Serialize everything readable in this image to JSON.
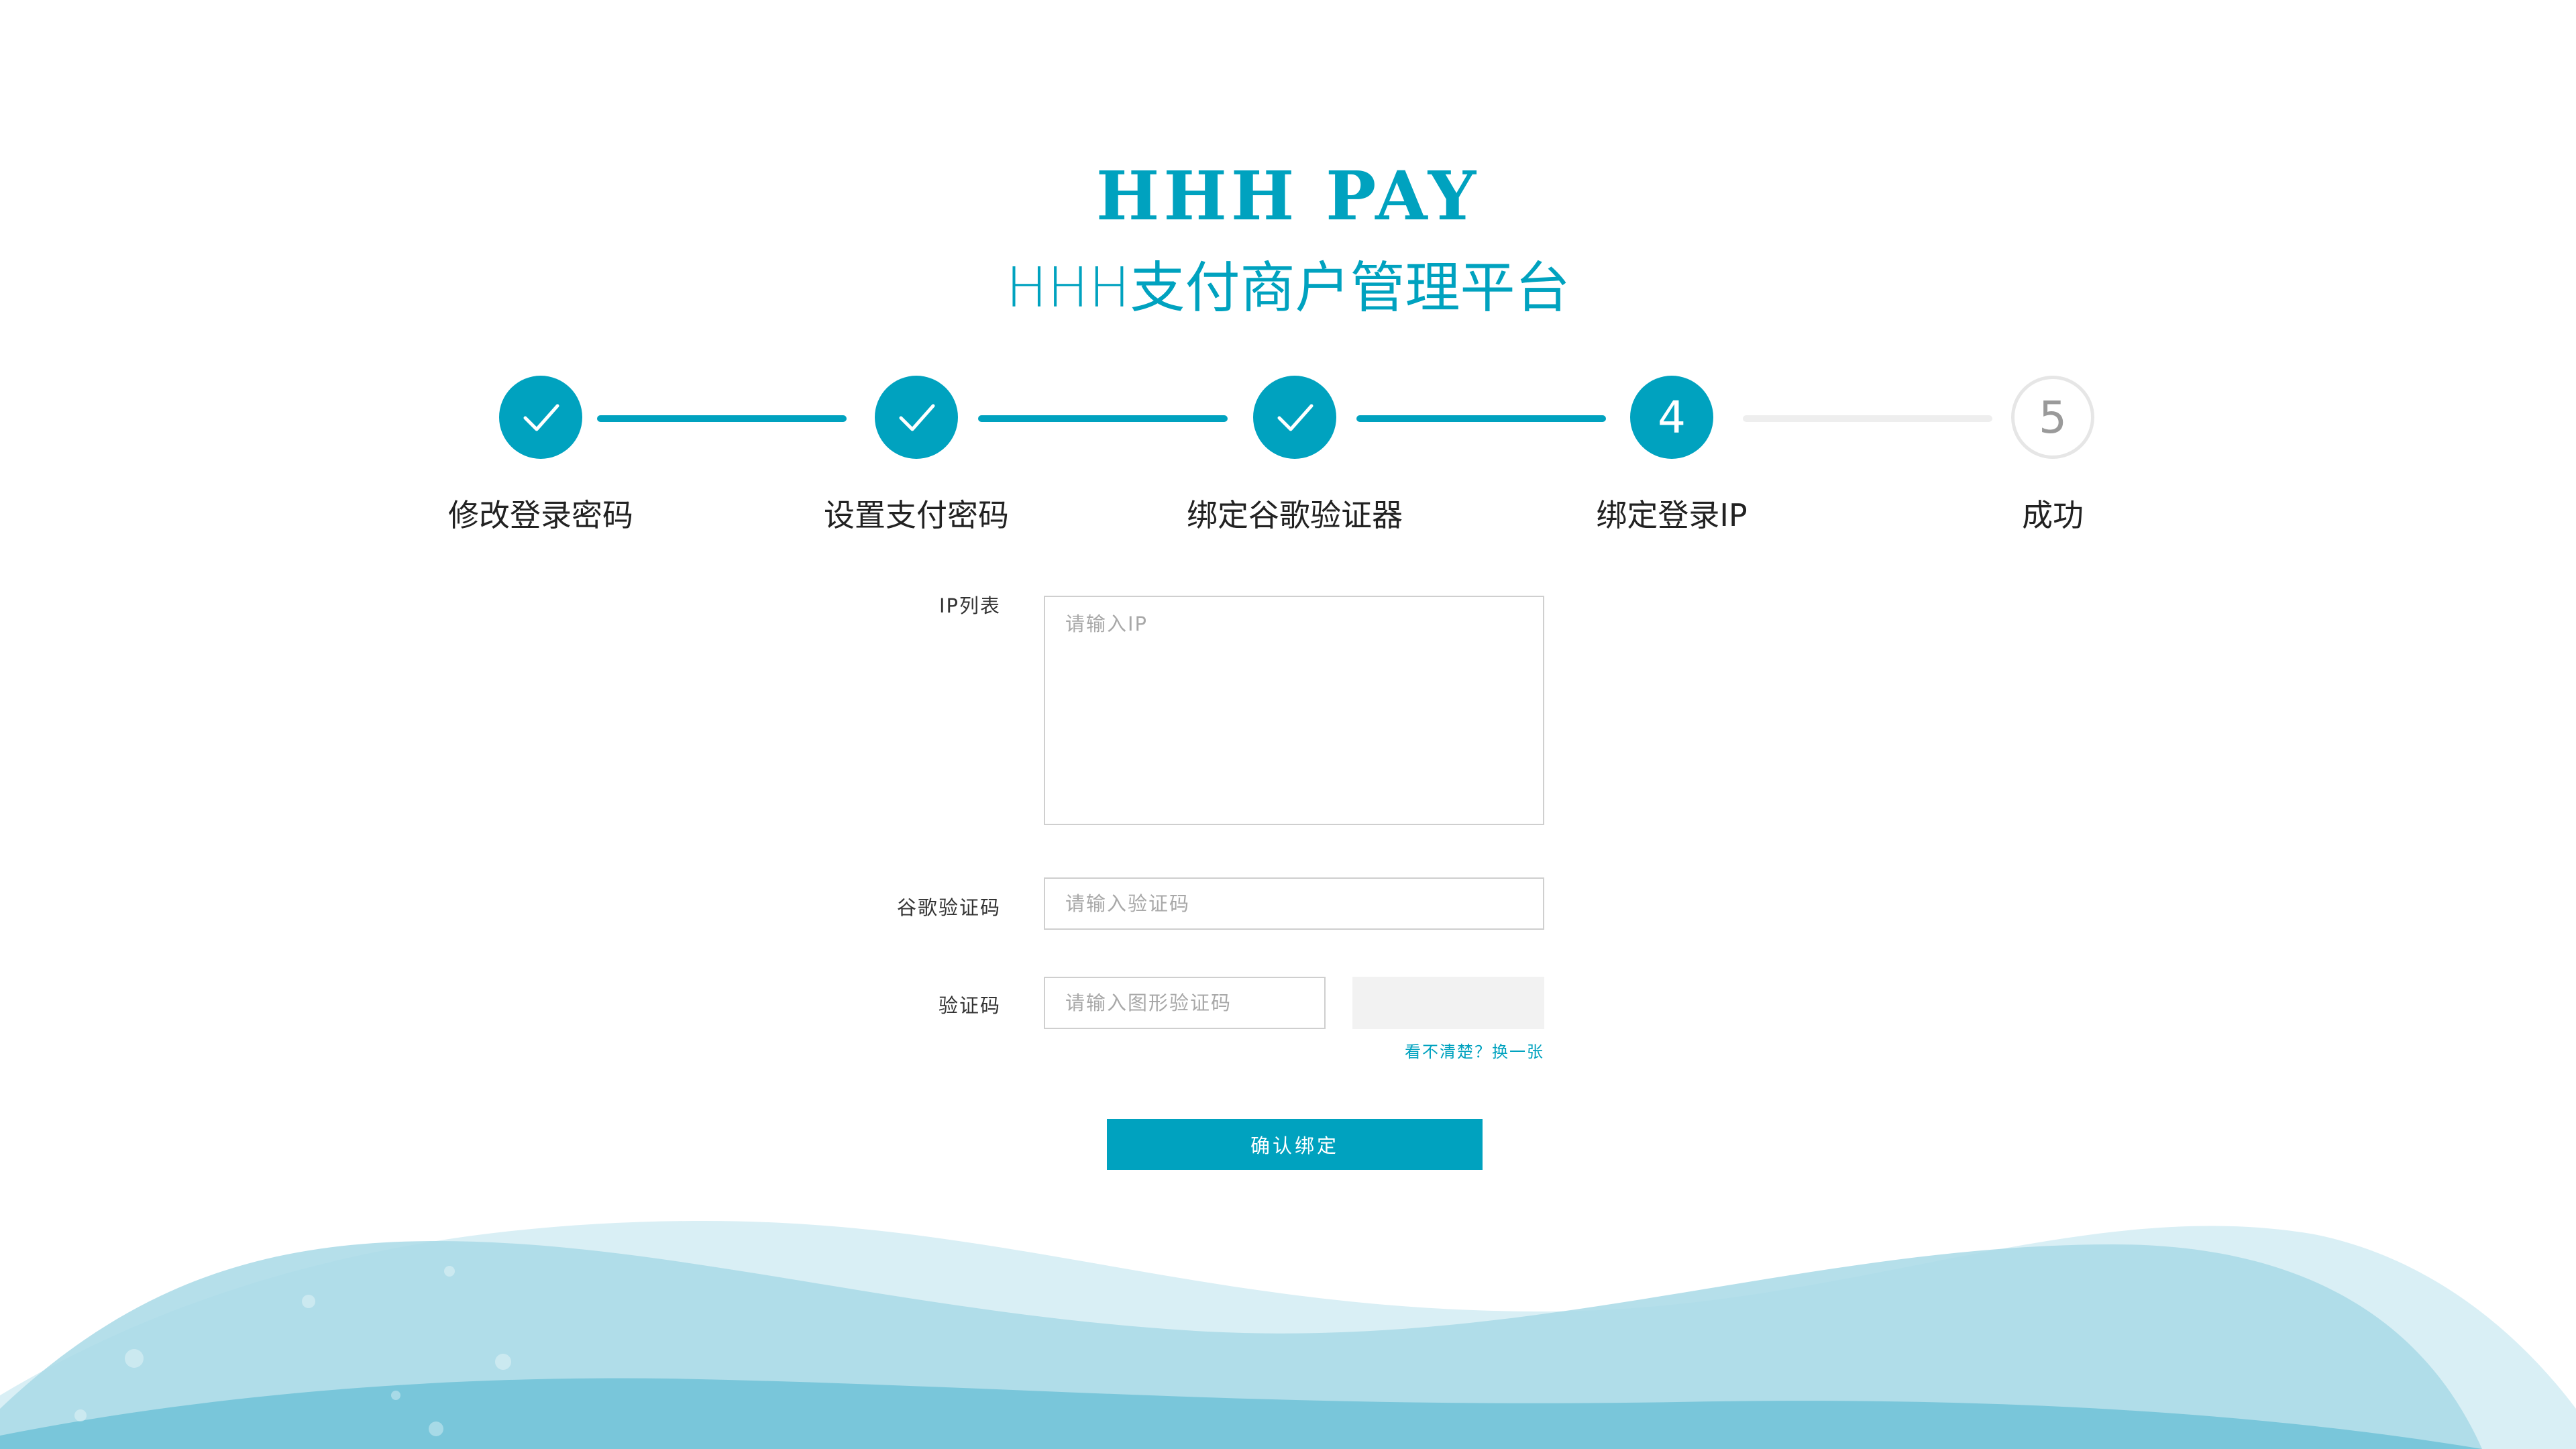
{
  "header": {
    "logo_text": "HHH PAY",
    "subtitle": "HHH支付商户管理平台"
  },
  "steps": [
    {
      "label": "修改登录密码",
      "status": "done",
      "icon": "check-icon"
    },
    {
      "label": "设置支付密码",
      "status": "done",
      "icon": "check-icon"
    },
    {
      "label": "绑定谷歌验证器",
      "status": "done",
      "icon": "check-icon"
    },
    {
      "label": "绑定登录IP",
      "status": "active",
      "number": "4"
    },
    {
      "label": "成功",
      "status": "todo",
      "number": "5"
    }
  ],
  "form": {
    "ip_label": "IP列表",
    "ip_placeholder": "请输入IP",
    "google_label": "谷歌验证码",
    "google_placeholder": "请输入验证码",
    "captcha_label": "验证码",
    "captcha_placeholder": "请输入图形验证码",
    "refresh_text": "看不清楚？换一张",
    "submit_label": "确认绑定"
  },
  "colors": {
    "primary": "#00a2bf",
    "inactive_line": "#eeeeee",
    "wave_light": "#d9eff5",
    "wave_mid": "#a8d9e6",
    "wave_dark": "#6cc0d6"
  }
}
